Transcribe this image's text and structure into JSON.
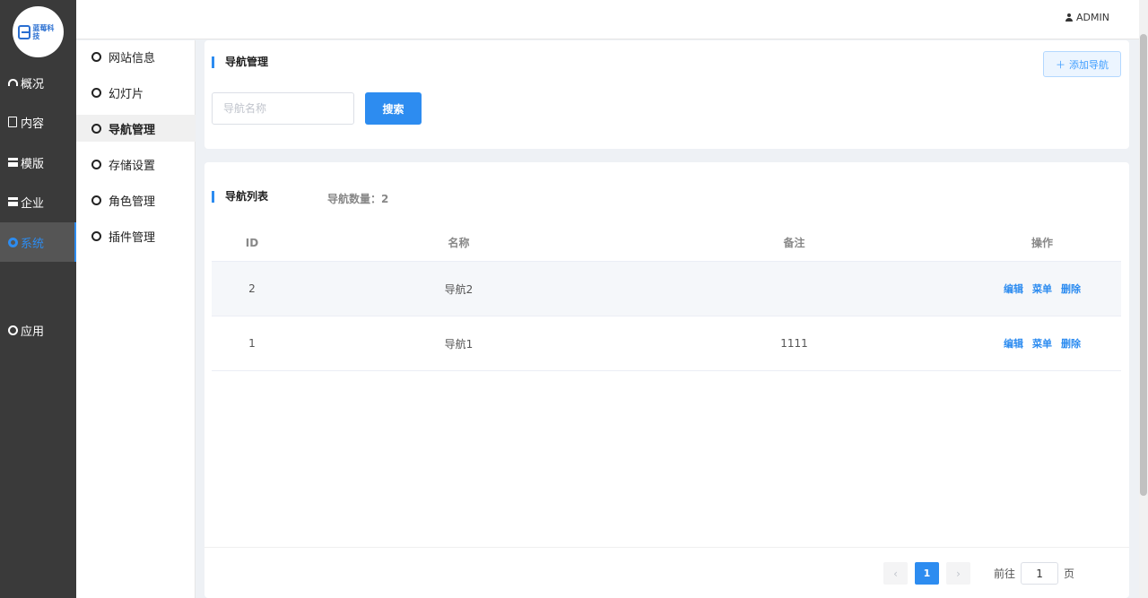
{
  "colors": {
    "accent": "#2d8cf0",
    "sidebar_bg": "#3a3a3a"
  },
  "logo": {
    "text": "蓝莓科技"
  },
  "header": {
    "user": "ADMIN"
  },
  "sidebar": {
    "items": [
      {
        "label": "概况",
        "icon": "dashboard-icon"
      },
      {
        "label": "内容",
        "icon": "document-icon"
      },
      {
        "label": "模版",
        "icon": "box-icon"
      },
      {
        "label": "企业",
        "icon": "box-icon"
      },
      {
        "label": "系统",
        "icon": "gear-icon",
        "active": true
      },
      {
        "label": "应用",
        "icon": "circle-icon"
      }
    ]
  },
  "submenu": {
    "items": [
      {
        "label": "网站信息"
      },
      {
        "label": "幻灯片"
      },
      {
        "label": "导航管理",
        "active": true
      },
      {
        "label": "存储设置"
      },
      {
        "label": "角色管理"
      },
      {
        "label": "插件管理"
      }
    ]
  },
  "search_card": {
    "title": "导航管理",
    "add_button": "添加导航",
    "search_placeholder": "导航名称",
    "search_button": "搜索"
  },
  "list_card": {
    "title": "导航列表",
    "count_text": "导航数量：2",
    "columns": [
      "ID",
      "名称",
      "备注",
      "操作"
    ],
    "rows": [
      {
        "id": "2",
        "name": "导航2",
        "remark": "",
        "ops": [
          "编辑",
          "菜单",
          "删除"
        ]
      },
      {
        "id": "1",
        "name": "导航1",
        "remark": "1111",
        "ops": [
          "编辑",
          "菜单",
          "删除"
        ]
      }
    ]
  },
  "pagination": {
    "prev": "‹",
    "next": "›",
    "current_page": "1",
    "goto_prefix": "前往",
    "goto_value": "1",
    "goto_suffix": "页"
  }
}
